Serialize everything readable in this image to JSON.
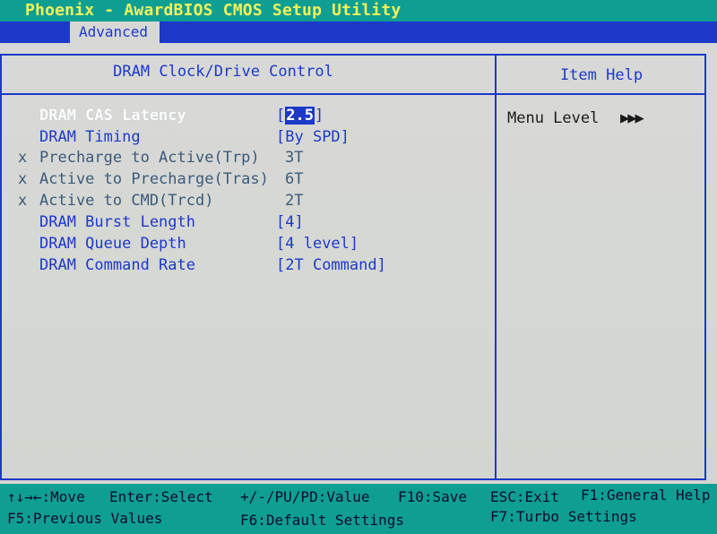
{
  "window": {
    "title": "Phoenix - AwardBIOS CMOS Setup Utility"
  },
  "menu": {
    "tabs": [
      {
        "label": "Advanced",
        "active": true
      }
    ]
  },
  "panel": {
    "title": "DRAM Clock/Drive Control",
    "settings": [
      {
        "label": "DRAM CAS Latency",
        "value": "2.5",
        "disabled": false,
        "selected": true
      },
      {
        "label": "DRAM Timing",
        "value": "By SPD",
        "disabled": false,
        "selected": false
      },
      {
        "label": "Precharge to Active(Trp)",
        "value": "3T",
        "disabled": true,
        "selected": false
      },
      {
        "label": "Active to Precharge(Tras)",
        "value": "6T",
        "disabled": true,
        "selected": false
      },
      {
        "label": "Active to CMD(Trcd)",
        "value": "2T",
        "disabled": true,
        "selected": false
      },
      {
        "label": "DRAM Burst Length",
        "value": "4",
        "disabled": false,
        "selected": false
      },
      {
        "label": "DRAM Queue Depth",
        "value": "4 level",
        "disabled": false,
        "selected": false
      },
      {
        "label": "DRAM Command Rate",
        "value": "2T Command",
        "disabled": false,
        "selected": false
      }
    ],
    "disabled_marker": "x",
    "bracket_open": "[",
    "bracket_close": "]"
  },
  "help": {
    "title": "Item Help",
    "menu_level_label": "Menu Level",
    "menu_level_arrows": "▶▶▶"
  },
  "footer": {
    "move": "↑↓→←:Move",
    "enter": "Enter:Select",
    "value": "+/-/PU/PD:Value",
    "f10": "F10:Save",
    "esc": "ESC:Exit",
    "f1": "F1:General Help",
    "f5": "F5:Previous Values",
    "f6": "F6:Default Settings",
    "f7": "F7:Turbo Settings"
  },
  "colors": {
    "title_bar": "#0e9f92",
    "title_text": "#f2f25a",
    "menu_bar": "#1d39c8",
    "panel_background": "#d7d8d6",
    "label_text": "#1d39c8",
    "disabled_text": "#3a5a7a",
    "selected_text": "#ffffff"
  }
}
